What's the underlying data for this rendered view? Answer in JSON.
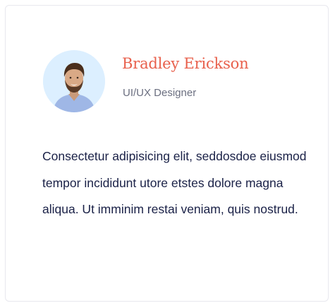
{
  "testimonial": {
    "name": "Bradley Erickson",
    "role": "UI/UX Designer",
    "quote": "Consectetur adipisicing elit, seddosdoe eiusmod tempor incididunt utore etstes dolore magna aliqua. Ut imminim restai veniam, quis nostrud."
  },
  "colors": {
    "name_accent": "#e8604c",
    "avatar_bg": "#dcefff",
    "text": "#1a2147",
    "muted": "#6b6f80"
  },
  "icons": {
    "avatar": "person-avatar-photo"
  }
}
